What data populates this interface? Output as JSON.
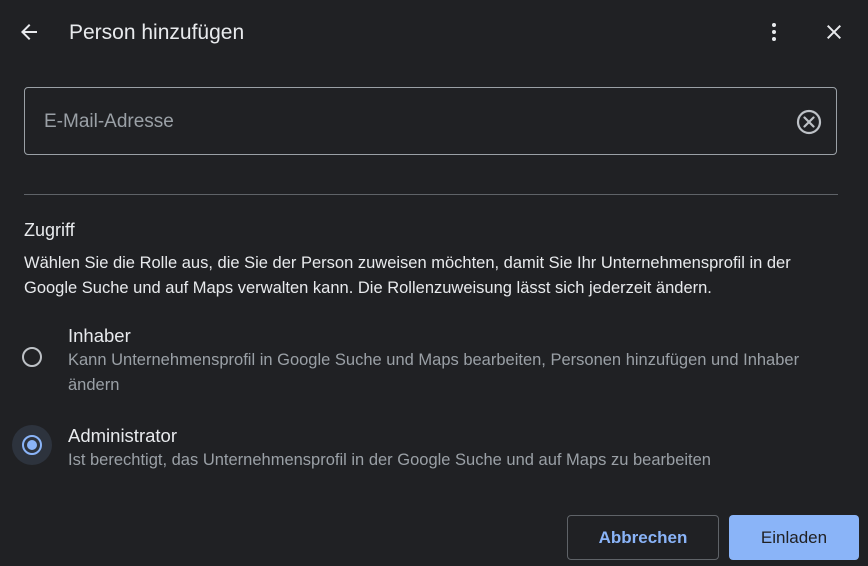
{
  "header": {
    "title": "Person hinzufügen"
  },
  "email": {
    "placeholder": "E-Mail-Adresse",
    "value": ""
  },
  "access": {
    "title": "Zugriff",
    "description": "Wählen Sie die Rolle aus, die Sie der Person zuweisen möchten, damit Sie Ihr Unternehmensprofil in der Google Suche und auf Maps verwalten kann. Die Rollenzuweisung lässt sich jederzeit ändern."
  },
  "roles": [
    {
      "label": "Inhaber",
      "description": "Kann Unternehmensprofil in Google Suche und Maps bearbeiten, Personen hinzufügen und Inhaber ändern",
      "selected": false
    },
    {
      "label": "Administrator",
      "description": "Ist berechtigt, das Unternehmensprofil in der Google Suche und auf Maps zu bearbeiten",
      "selected": true
    }
  ],
  "actions": {
    "cancel_label": "Abbrechen",
    "invite_label": "Einladen"
  },
  "colors": {
    "background": "#202124",
    "accent": "#8ab4f8",
    "text": "#e8eaed",
    "secondary_text": "#9aa0a6"
  }
}
